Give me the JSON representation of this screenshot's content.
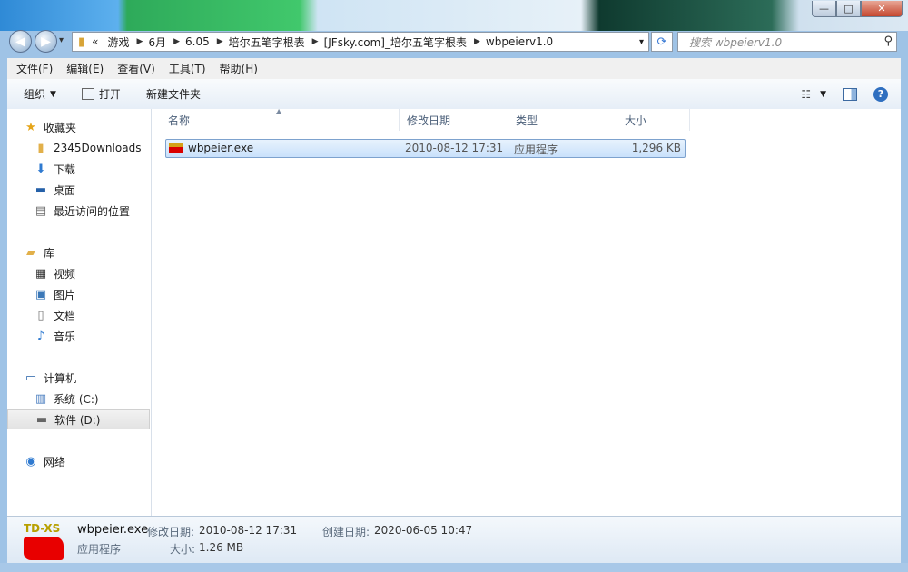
{
  "window": {
    "min": "—",
    "max": "□",
    "close": "✕"
  },
  "nav": {
    "back": "◀",
    "forward": "▶",
    "dropdown": "▾"
  },
  "address": {
    "overflow": "«",
    "crumbs": [
      "游戏",
      "6月",
      "6.05",
      "培尔五笔字根表",
      "[JFsky.com]_培尔五笔字根表",
      "wbpeierv1.0"
    ]
  },
  "search": {
    "placeholder": "搜索 wbpeierv1.0"
  },
  "menu": [
    "文件(F)",
    "编辑(E)",
    "查看(V)",
    "工具(T)",
    "帮助(H)"
  ],
  "toolbar": {
    "organize": "组织",
    "open": "打开",
    "new_folder": "新建文件夹"
  },
  "sidebar": {
    "favorites": "收藏夹",
    "fav_items": [
      "2345Downloads",
      "下载",
      "桌面",
      "最近访问的位置"
    ],
    "libraries": "库",
    "lib_items": [
      "视频",
      "图片",
      "文档",
      "音乐"
    ],
    "computer": "计算机",
    "drives": [
      "系统 (C:)",
      "软件 (D:)"
    ],
    "network": "网络"
  },
  "columns": [
    "名称",
    "修改日期",
    "类型",
    "大小"
  ],
  "files": [
    {
      "name": "wbpeier.exe",
      "modified": "2010-08-12 17:31",
      "type": "应用程序",
      "size": "1,296 KB"
    }
  ],
  "details": {
    "thumb_text": "TD-XS",
    "name": "wbpeier.exe",
    "modified_label": "修改日期:",
    "modified": "2010-08-12 17:31",
    "created_label": "创建日期:",
    "created": "2020-06-05 10:47",
    "type": "应用程序",
    "size_label": "大小:",
    "size": "1.26 MB"
  },
  "colors": {
    "selection": "#cce4fb",
    "accent": "#3a7bd5",
    "toolbar": "#e6eef7"
  }
}
